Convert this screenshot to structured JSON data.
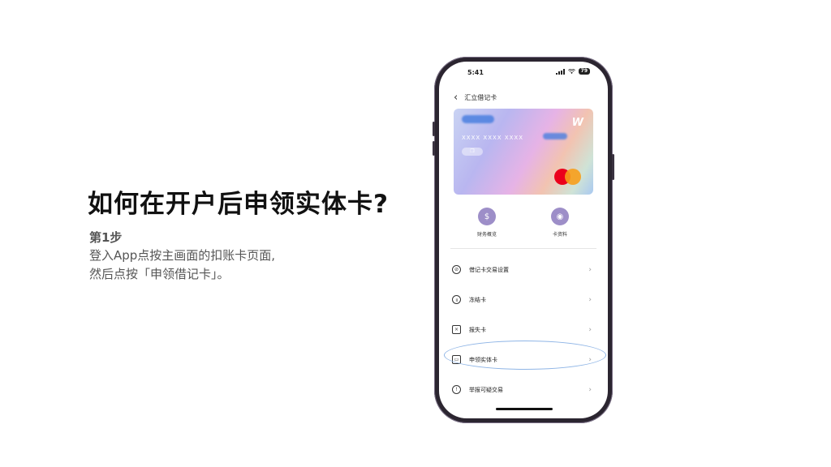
{
  "headline": "如何在开户后申领实体卡?",
  "step": {
    "title": "第1步",
    "line1": "登入App点按主画面的扣账卡页面,",
    "line2": "然后点按「申领借记卡」。"
  },
  "phone": {
    "status_time": "5:41",
    "battery": "79",
    "nav_title": "汇立借记卡",
    "card": {
      "number": "XXXX XXXX XXXX",
      "brand_logo": "W",
      "network": "mastercard"
    },
    "quick_actions": [
      {
        "label": "财务概览",
        "icon": "dollar-coin-icon"
      },
      {
        "label": "卡资料",
        "icon": "eye-icon"
      }
    ],
    "menu": [
      {
        "label": "借记卡交易设置",
        "icon": "no-entry-icon"
      },
      {
        "label": "冻结卡",
        "icon": "pause-icon"
      },
      {
        "label": "报失卡",
        "icon": "report-icon"
      },
      {
        "label": "申领实体卡",
        "icon": "credit-card-icon"
      },
      {
        "label": "举报可疑交易",
        "icon": "alert-icon"
      }
    ],
    "highlight_color": "#8fb5e6",
    "accent_color": "#9d8ec8"
  }
}
